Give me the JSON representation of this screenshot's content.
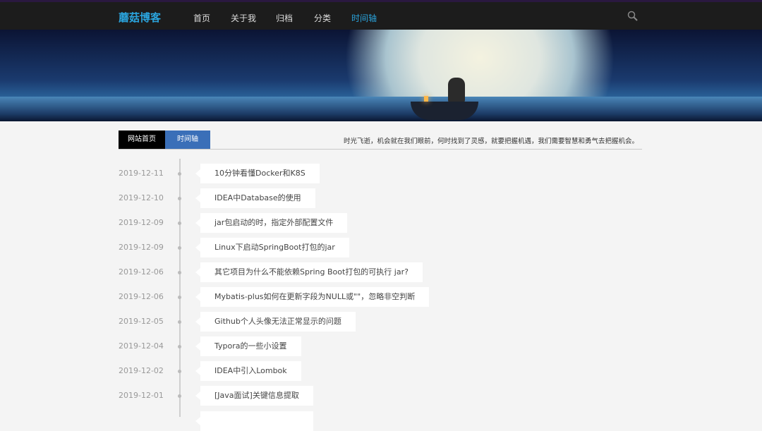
{
  "header": {
    "logo": "蘑菇博客",
    "nav": [
      "首页",
      "关于我",
      "归档",
      "分类",
      "时间轴"
    ],
    "active_nav": "时间轴"
  },
  "tabs": {
    "home": "网站首页",
    "timeline": "时间轴"
  },
  "motto": "时光飞逝，机会就在我们眼前，何时找到了灵感，就要把握机遇，我们需要智慧和勇气去把握机会。",
  "timeline": [
    {
      "date": "2019-12-11",
      "title": "10分钟看懂Docker和K8S"
    },
    {
      "date": "2019-12-10",
      "title": "IDEA中Database的使用"
    },
    {
      "date": "2019-12-09",
      "title": "jar包启动的时，指定外部配置文件"
    },
    {
      "date": "2019-12-09",
      "title": "Linux下启动SpringBoot打包的jar"
    },
    {
      "date": "2019-12-06",
      "title": "其它项目为什么不能依赖Spring Boot打包的可执行 jar?"
    },
    {
      "date": "2019-12-06",
      "title": "Mybatis-plus如何在更新字段为NULL或\"\"，忽略非空判断"
    },
    {
      "date": "2019-12-05",
      "title": "Github个人头像无法正常显示的问题"
    },
    {
      "date": "2019-12-04",
      "title": "Typora的一些小设置"
    },
    {
      "date": "2019-12-02",
      "title": "IDEA中引入Lombok"
    },
    {
      "date": "2019-12-01",
      "title": "[Java面试]关键信息提取"
    }
  ]
}
